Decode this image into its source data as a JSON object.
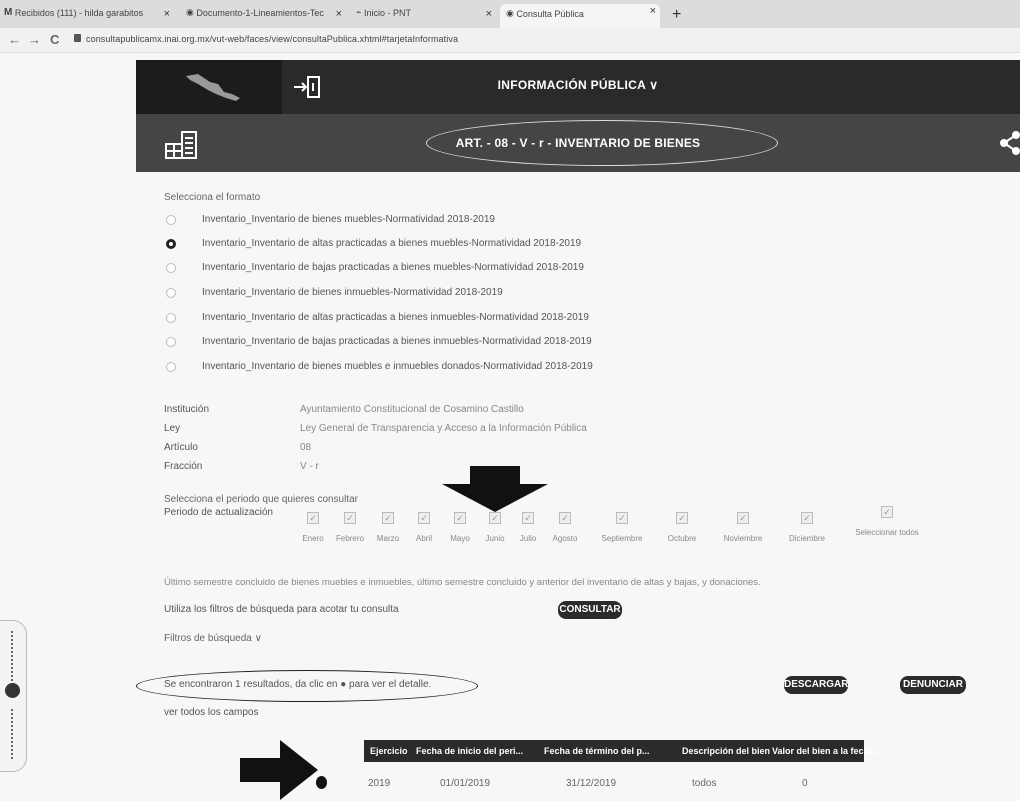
{
  "browser": {
    "tabs": [
      {
        "title": "Recibidos (111) - hilda garabitos",
        "icon": "gmail-icon"
      },
      {
        "title": "Documento-1-Lineamientos-Tec",
        "icon": "globe-icon"
      },
      {
        "title": "Inicio - PNT",
        "icon": "pnt-icon"
      },
      {
        "title": "Consulta Pública",
        "icon": "globe-icon"
      }
    ],
    "close_glyph": "×",
    "new_tab_glyph": "+",
    "back_glyph": "←",
    "forward_glyph": "→",
    "reload_glyph": "C",
    "url": "consultapublicamx.inai.org.mx/vut-web/faces/view/consultaPublica.xhtml#tarjetaInformativa"
  },
  "header": {
    "menu_title": "INFORMACIÓN PÚBLICA ∨",
    "section_title": "ART. - 08 - V - r - INVENTARIO DE BIENES"
  },
  "form": {
    "format_prompt": "Selecciona el formato",
    "formats": [
      {
        "label": "Inventario_Inventario de bienes muebles-Normatividad 2018-2019",
        "selected": false
      },
      {
        "label": "Inventario_Inventario de altas practicadas a bienes muebles-Normatividad 2018-2019",
        "selected": true
      },
      {
        "label": "Inventario_Inventario de bajas practicadas a bienes muebles-Normatividad 2018-2019",
        "selected": false
      },
      {
        "label": "Inventario_Inventario de bienes inmuebles-Normatividad 2018-2019",
        "selected": false
      },
      {
        "label": "Inventario_Inventario de altas practicadas a bienes inmuebles-Normatividad 2018-2019",
        "selected": false
      },
      {
        "label": "Inventario_Inventario de bajas practicadas a bienes inmuebles-Normatividad 2018-2019",
        "selected": false
      },
      {
        "label": "Inventario_Inventario de bienes muebles e inmuebles donados-Normatividad 2018-2019",
        "selected": false
      }
    ],
    "meta": [
      {
        "label": "Institución",
        "value": "Ayuntamiento Constitucional de Cosamino Castillo"
      },
      {
        "label": "Ley",
        "value": "Ley General de Transparencia y Acceso a la Información Pública"
      },
      {
        "label": "Artículo",
        "value": "08"
      },
      {
        "label": "Fracción",
        "value": "V - r"
      }
    ],
    "period_prompt": "Selecciona el periodo que quieres consultar",
    "period_label": "Periodo de actualización",
    "months": [
      "Enero",
      "Febrero",
      "Marzo",
      "Abril",
      "Mayo",
      "Junio",
      "Julio",
      "Agosto",
      "Septiembre",
      "Octubre",
      "Noviembre",
      "Diciembre"
    ],
    "select_all": "Seleccionar todos",
    "checkmark": "✓",
    "period_note": "Último semestre concluido de bienes muebles e inmuebles, último semestre concluido y anterior del inventario de altas y bajas, y donaciones.",
    "filters_hint": "Utiliza los filtros de búsqueda para acotar tu consulta",
    "consult_button": "CONSULTAR",
    "filters_toggle": "Filtros de búsqueda ∨"
  },
  "results": {
    "summary": "Se encontraron 1 resultados, da clic en ● para ver el detalle.",
    "download_button": "DESCARGAR",
    "report_button": "DENUNCIAR",
    "show_all_fields": "ver todos los campos",
    "columns": [
      "Ejercicio",
      "Fecha de inicio del peri...",
      "Fecha de término del p...",
      "Descripción del bien",
      "Valor del bien a la fecha..."
    ],
    "rows": [
      [
        "2019",
        "01/01/2019",
        "31/12/2019",
        "todos",
        "0"
      ]
    ]
  }
}
